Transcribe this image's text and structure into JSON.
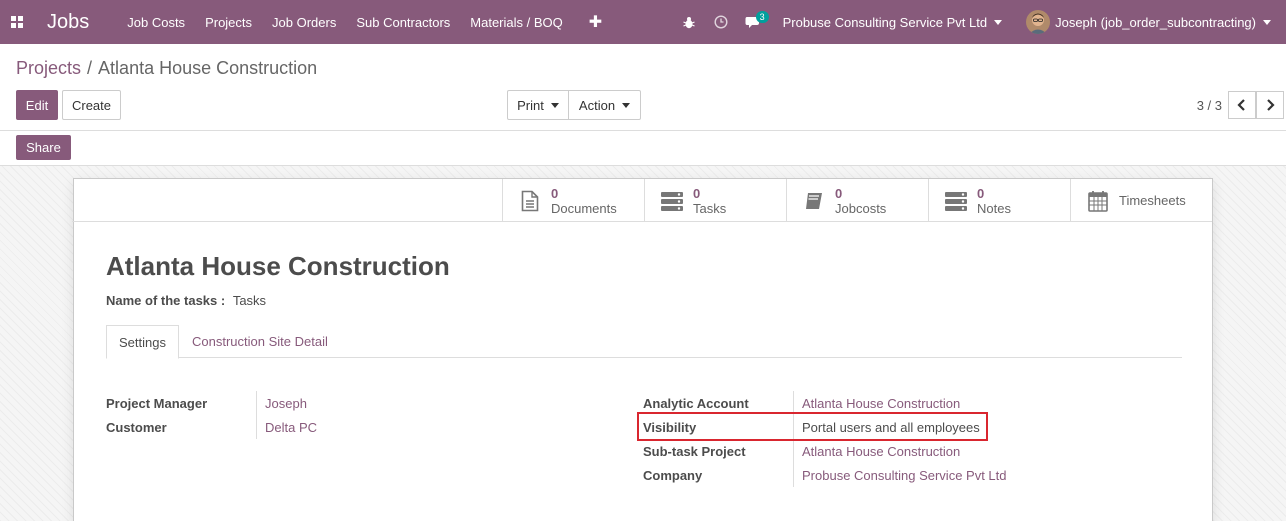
{
  "navbar": {
    "brand": "Jobs",
    "menu": [
      "Job Costs",
      "Projects",
      "Job Orders",
      "Sub Contractors",
      "Materials / BOQ"
    ],
    "plus": "✚",
    "chat_badge": "3",
    "company": "Probuse Consulting Service Pvt Ltd",
    "user": "Joseph (job_order_subcontracting)"
  },
  "breadcrumb": {
    "parent": "Projects",
    "separator": "/",
    "current": "Atlanta House Construction"
  },
  "buttons": {
    "edit": "Edit",
    "create": "Create",
    "print": "Print",
    "action": "Action",
    "share": "Share"
  },
  "pager": {
    "value": "3 / 3"
  },
  "stat_buttons": [
    {
      "value": "0",
      "label": "Documents",
      "icon": "document-icon"
    },
    {
      "value": "0",
      "label": "Tasks",
      "icon": "tasks-icon"
    },
    {
      "value": "0",
      "label": "Jobcosts",
      "icon": "book-icon"
    },
    {
      "value": "0",
      "label": "Notes",
      "icon": "notes-icon"
    },
    {
      "label": "Timesheets",
      "icon": "calendar-icon"
    }
  ],
  "record": {
    "title": "Atlanta House Construction",
    "task_name_label": "Name of the tasks :",
    "task_name_value": "Tasks"
  },
  "tabs": [
    "Settings",
    "Construction Site Detail"
  ],
  "fields_left": [
    {
      "label": "Project Manager",
      "value": "Joseph"
    },
    {
      "label": "Customer",
      "value": "Delta PC"
    }
  ],
  "fields_right": [
    {
      "label": "Analytic Account",
      "value": "Atlanta House Construction"
    },
    {
      "label": "Visibility",
      "value": "Portal users and all employees"
    },
    {
      "label": "Sub-task Project",
      "value": "Atlanta House Construction"
    },
    {
      "label": "Company",
      "value": "Probuse Consulting Service Pvt Ltd"
    }
  ],
  "colors": {
    "brand": "#875a7b",
    "badge": "#00a09d",
    "highlight": "#d9262f"
  }
}
